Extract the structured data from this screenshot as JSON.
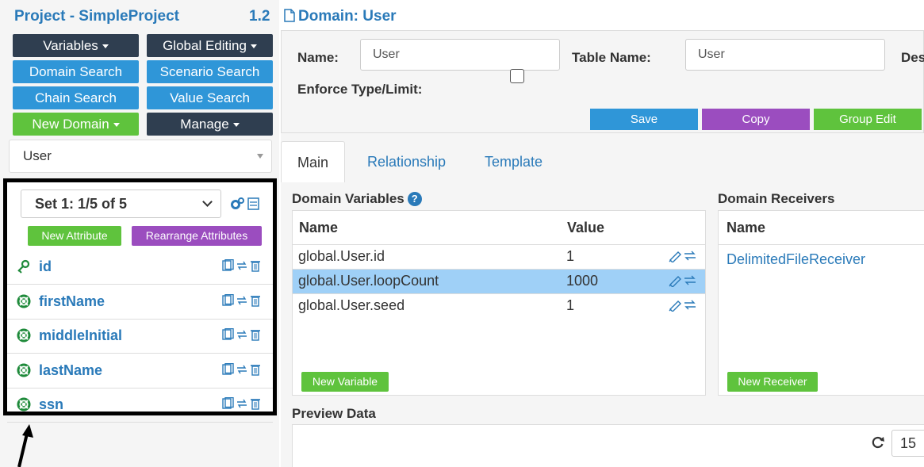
{
  "project": {
    "title": "Project - SimpleProject",
    "version": "1.2"
  },
  "left_buttons": {
    "variables": "Variables",
    "global_editing": "Global Editing",
    "domain_search": "Domain Search",
    "scenario_search": "Scenario Search",
    "chain_search": "Chain Search",
    "value_search": "Value Search",
    "new_domain": "New Domain",
    "manage": "Manage"
  },
  "domain_select": {
    "value": "User"
  },
  "attributes": {
    "set_select": "Set 1: 1/5 of 5",
    "new_attribute": "New Attribute",
    "rearrange": "Rearrange Attributes",
    "items": [
      {
        "name": "id",
        "icon": "key-icon"
      },
      {
        "name": "firstName",
        "icon": "lifebuoy-icon"
      },
      {
        "name": "middleInitial",
        "icon": "lifebuoy-icon"
      },
      {
        "name": "lastName",
        "icon": "lifebuoy-icon"
      },
      {
        "name": "ssn",
        "icon": "lifebuoy-icon"
      }
    ]
  },
  "domain": {
    "title": "Domain: User",
    "name_label": "Name:",
    "name_value": "User",
    "table_name_label": "Table Name:",
    "table_name_value": "User",
    "desc_label_partial": "Des",
    "enforce_label": "Enforce Type/Limit:",
    "actions": {
      "save": "Save",
      "copy": "Copy",
      "group_edit": "Group Edit"
    }
  },
  "tabs": [
    "Main",
    "Relationship",
    "Template"
  ],
  "domain_variables": {
    "title": "Domain Variables",
    "help": "?",
    "columns": [
      "Name",
      "Value"
    ],
    "rows": [
      {
        "name": "global.User.id",
        "value": "1"
      },
      {
        "name": "global.User.loopCount",
        "value": "1000"
      },
      {
        "name": "global.User.seed",
        "value": "1"
      }
    ],
    "new_button": "New Variable"
  },
  "domain_receivers": {
    "title": "Domain Receivers",
    "columns": [
      "Name"
    ],
    "rows": [
      "DelimitedFileReceiver"
    ],
    "new_button": "New Receiver"
  },
  "preview": {
    "title": "Preview Data",
    "page_size": "15"
  },
  "colors": {
    "accent": "#2a7ab9",
    "dark_button": "#2f3e50",
    "blue_button": "#2f96d8",
    "green_button": "#5fc33d",
    "purple_button": "#9b4dbf",
    "selected_row": "#9fd0f7"
  }
}
